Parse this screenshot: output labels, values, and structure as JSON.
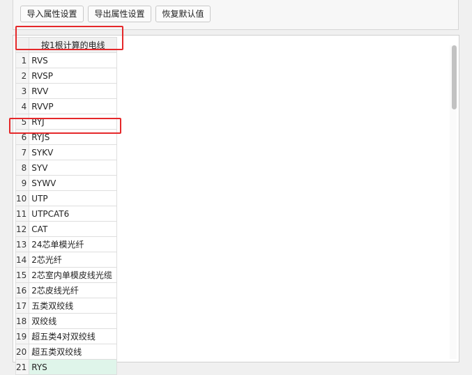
{
  "toolbar": {
    "import_label": "导入属性设置",
    "export_label": "导出属性设置",
    "reset_label": "恢复默认值"
  },
  "grid": {
    "column_header": "按1根计算的电线",
    "rows": [
      {
        "num": "1",
        "value": "RVS"
      },
      {
        "num": "2",
        "value": "RVSP"
      },
      {
        "num": "3",
        "value": "RVV"
      },
      {
        "num": "4",
        "value": "RVVP"
      },
      {
        "num": "5",
        "value": "RYJ"
      },
      {
        "num": "6",
        "value": "RYJS"
      },
      {
        "num": "7",
        "value": "SYKV"
      },
      {
        "num": "8",
        "value": "SYV"
      },
      {
        "num": "9",
        "value": "SYWV"
      },
      {
        "num": "10",
        "value": "UTP"
      },
      {
        "num": "11",
        "value": "UTPCAT6"
      },
      {
        "num": "12",
        "value": "CAT"
      },
      {
        "num": "13",
        "value": "24芯单模光纤"
      },
      {
        "num": "14",
        "value": "2芯光纤"
      },
      {
        "num": "15",
        "value": "2芯室内单模皮线光缆"
      },
      {
        "num": "16",
        "value": "2芯皮线光纤"
      },
      {
        "num": "17",
        "value": "五类双绞线"
      },
      {
        "num": "18",
        "value": "双绞线"
      },
      {
        "num": "19",
        "value": "超五类4对双绞线"
      },
      {
        "num": "20",
        "value": "超五类双绞线"
      },
      {
        "num": "21",
        "value": "RYS"
      }
    ],
    "selected_row": "21"
  },
  "colors": {
    "highlight": "#e5282a",
    "selected_row": "#dff5ea"
  }
}
